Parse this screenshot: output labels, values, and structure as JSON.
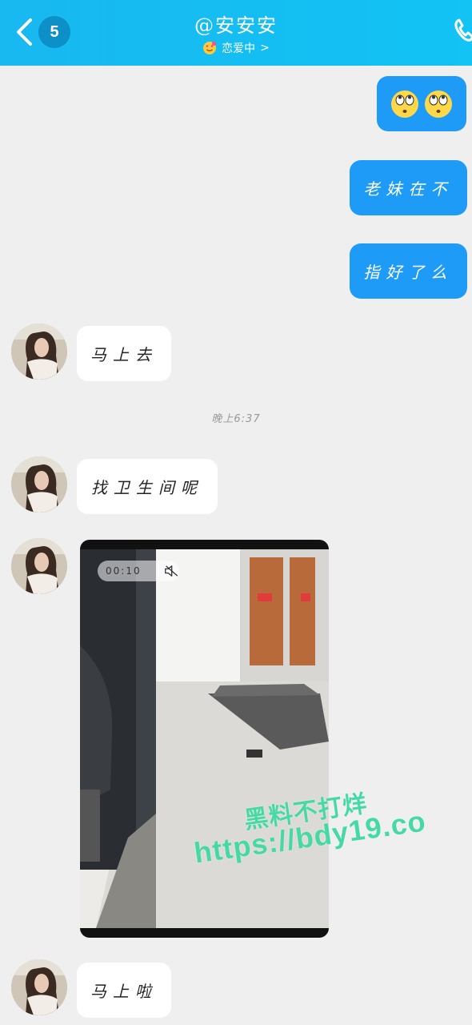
{
  "header": {
    "unread_count": "5",
    "title": "@安安安",
    "status": "恋爱中",
    "status_chevron": ">",
    "back_icon": "chevron-left-icon",
    "call_icon": "phone-icon"
  },
  "messages": [
    {
      "side": "out",
      "text": "",
      "type": "emoji",
      "emoji": "eye-roll-emoji x2"
    },
    {
      "side": "out",
      "text": "老妹在不"
    },
    {
      "side": "out",
      "text": "指好了么"
    },
    {
      "side": "in",
      "text": "马上去"
    },
    {
      "side": "in",
      "text": "找卫生间呢"
    },
    {
      "side": "in",
      "type": "video",
      "duration": "00:10"
    },
    {
      "side": "in",
      "text": "马上啦"
    }
  ],
  "timestamp": "晚上6:37",
  "watermark": {
    "line1": "黑料不打烊",
    "line2": "https://bdy19.co"
  },
  "colors": {
    "header": "#18b8f0",
    "outgoing_bubble": "#1e9bf7",
    "incoming_bubble": "#ffffff",
    "background": "#efefef",
    "watermark": "#46d9a6"
  }
}
